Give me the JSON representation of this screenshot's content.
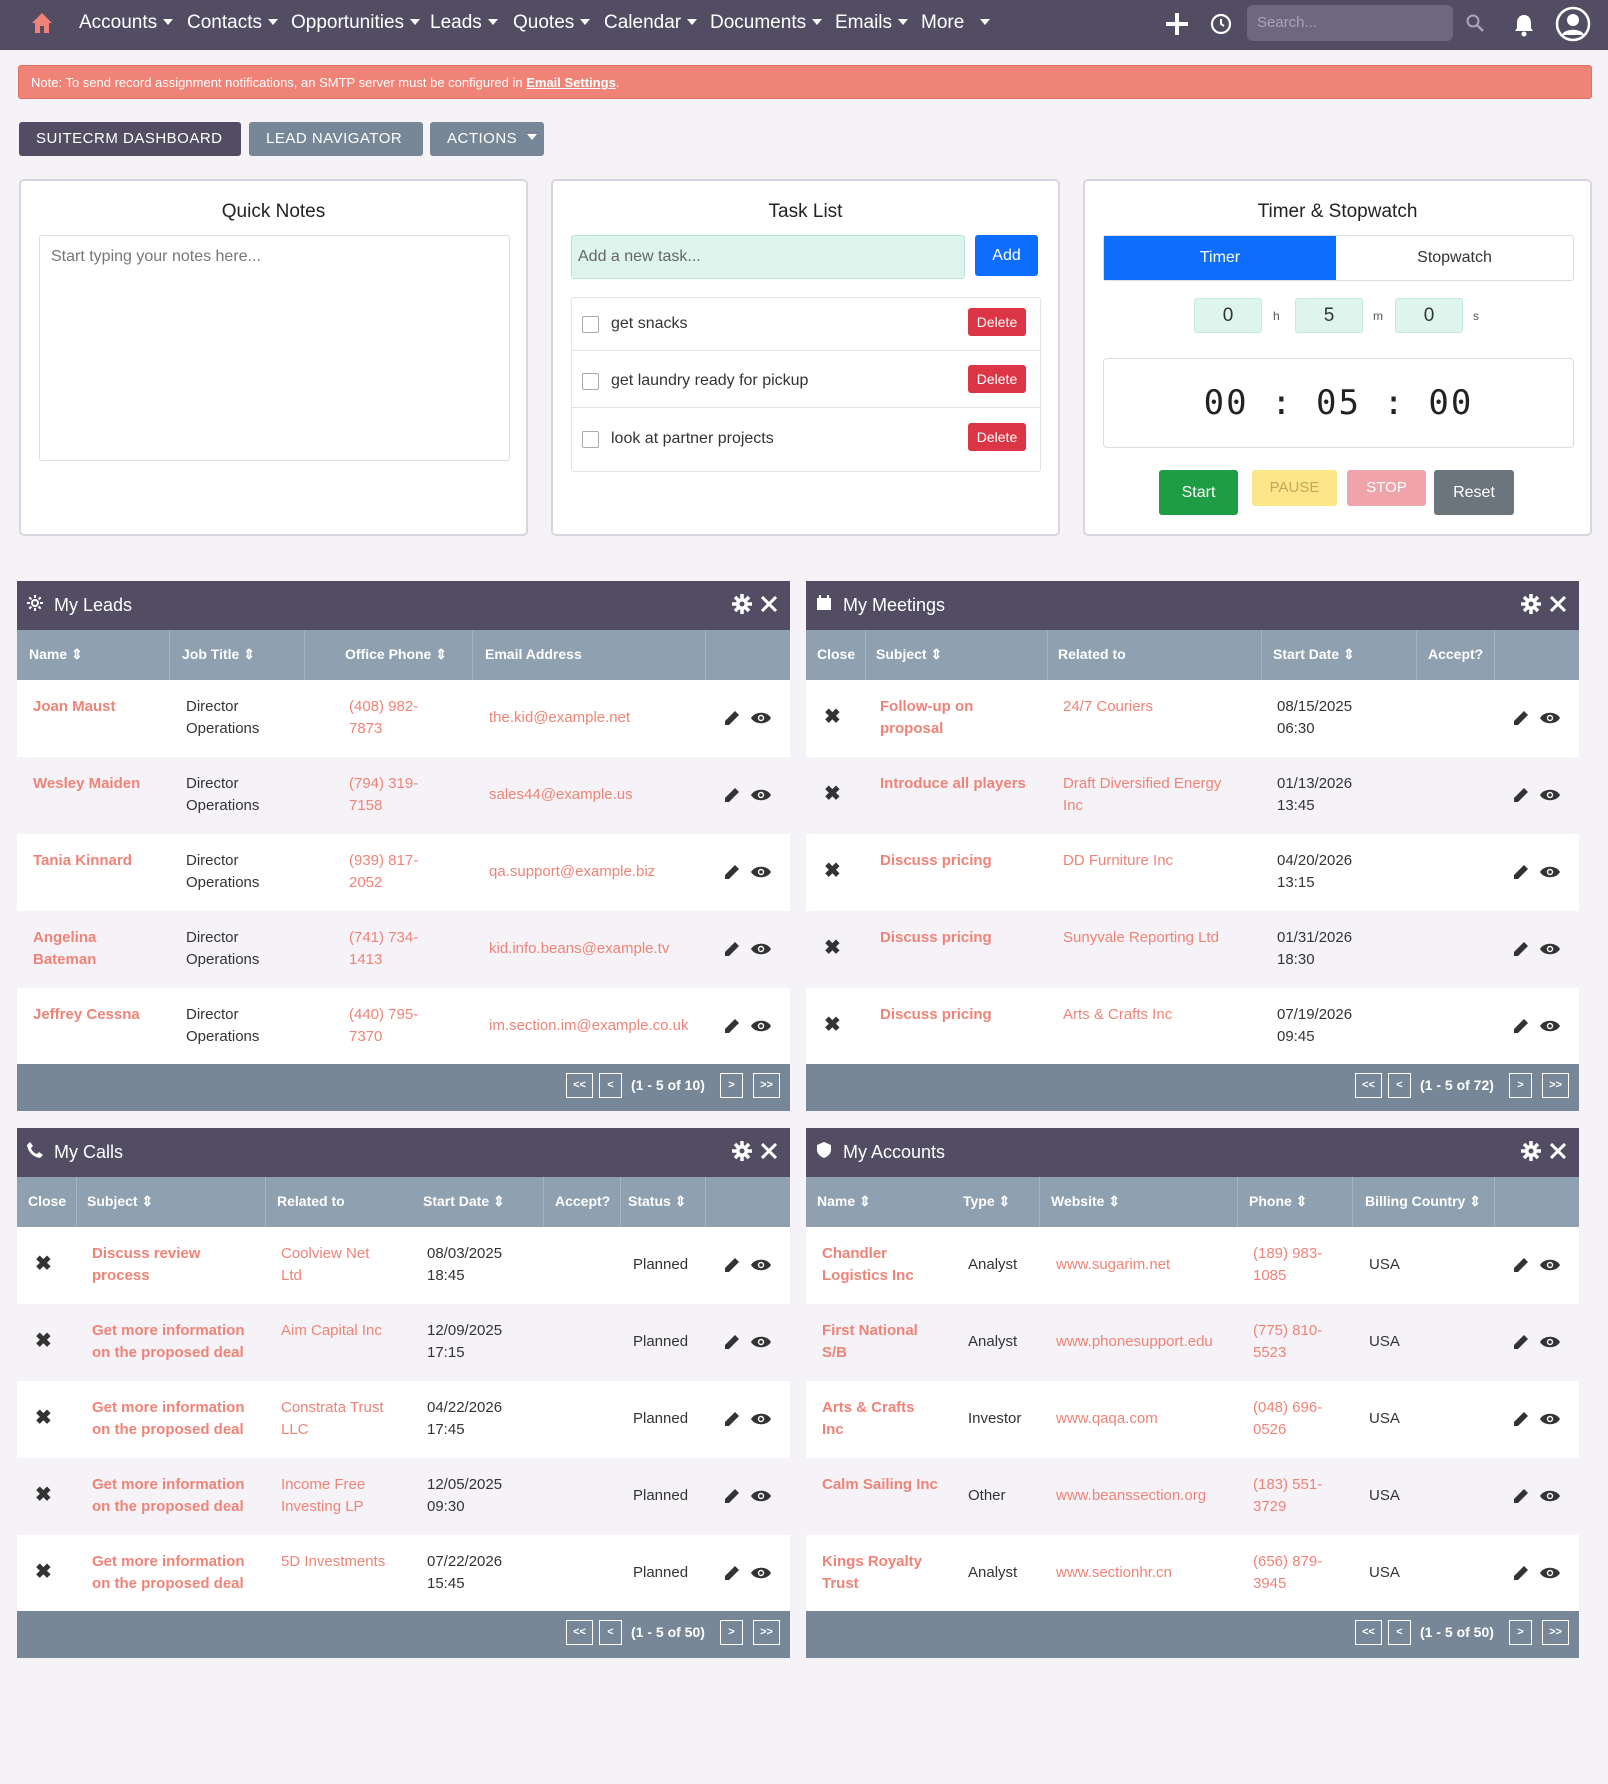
{
  "nav": {
    "items": [
      "Accounts",
      "Contacts",
      "Opportunities",
      "Leads",
      "Quotes",
      "Calendar",
      "Documents",
      "Emails",
      "More"
    ],
    "search_placeholder": "Search..."
  },
  "notice": {
    "text": "Note: To send record assignment notifications, an SMTP server must be configured in ",
    "link": "Email Settings",
    "end": "."
  },
  "tabs": {
    "dashboard": "SUITECRM DASHBOARD",
    "navigator": "LEAD NAVIGATOR",
    "actions": "ACTIONS"
  },
  "quick_notes": {
    "title": "Quick Notes",
    "placeholder": "Start typing your notes here..."
  },
  "task_list": {
    "title": "Task List",
    "placeholder": "Add a new task...",
    "add": "Add",
    "delete": "Delete",
    "tasks": [
      "get snacks",
      "get laundry ready for pickup",
      "look at partner projects"
    ]
  },
  "timer": {
    "title": "Timer & Stopwatch",
    "tab_timer": "Timer",
    "tab_stopwatch": "Stopwatch",
    "h": "0",
    "m": "5",
    "s": "0",
    "h_label": "h",
    "m_label": "m",
    "s_label": "s",
    "display": "00 : 05 : 00",
    "start": "Start",
    "pause": "PAUSE",
    "stop": "STOP",
    "reset": "Reset"
  },
  "leads": {
    "title": "My Leads",
    "cols": [
      "Name",
      "Job Title",
      "Office Phone",
      "Email Address"
    ],
    "rows": [
      {
        "name": [
          "Joan Maust",
          ""
        ],
        "job": [
          "Director",
          "Operations"
        ],
        "phone": [
          "(408) 982-",
          "7873"
        ],
        "email": "the.kid@example.net"
      },
      {
        "name": [
          "Wesley Maiden",
          ""
        ],
        "job": [
          "Director",
          "Operations"
        ],
        "phone": [
          "(794) 319-",
          "7158"
        ],
        "email": "sales44@example.us"
      },
      {
        "name": [
          "Tania Kinnard",
          ""
        ],
        "job": [
          "Director",
          "Operations"
        ],
        "phone": [
          "(939) 817-",
          "2052"
        ],
        "email": "qa.support@example.biz"
      },
      {
        "name": [
          "Angelina",
          "Bateman"
        ],
        "job": [
          "Director",
          "Operations"
        ],
        "phone": [
          "(741) 734-",
          "1413"
        ],
        "email": "kid.info.beans@example.tv"
      },
      {
        "name": [
          "Jeffrey Cessna",
          ""
        ],
        "job": [
          "Director",
          "Operations"
        ],
        "phone": [
          "(440) 795-",
          "7370"
        ],
        "email": "im.section.im@example.co.uk"
      }
    ],
    "pager": "(1 - 5 of 10)"
  },
  "meetings": {
    "title": "My Meetings",
    "cols": [
      "Close",
      "Subject",
      "Related to",
      "Start Date",
      "Accept?"
    ],
    "rows": [
      {
        "subject": [
          "Follow-up on",
          "proposal"
        ],
        "related": [
          "24/7 Couriers",
          ""
        ],
        "date": [
          "08/15/2025",
          "06:30"
        ]
      },
      {
        "subject": [
          "Introduce all players",
          ""
        ],
        "related": [
          "Draft Diversified Energy",
          "Inc"
        ],
        "date": [
          "01/13/2026",
          "13:45"
        ]
      },
      {
        "subject": [
          "Discuss pricing",
          ""
        ],
        "related": [
          "DD Furniture Inc",
          ""
        ],
        "date": [
          "04/20/2026",
          "13:15"
        ]
      },
      {
        "subject": [
          "Discuss pricing",
          ""
        ],
        "related": [
          "Sunyvale Reporting Ltd",
          ""
        ],
        "date": [
          "01/31/2026",
          "18:30"
        ]
      },
      {
        "subject": [
          "Discuss pricing",
          ""
        ],
        "related": [
          "Arts & Crafts Inc",
          ""
        ],
        "date": [
          "07/19/2026",
          "09:45"
        ]
      }
    ],
    "pager": "(1 - 5 of 72)"
  },
  "calls": {
    "title": "My Calls",
    "cols": [
      "Close",
      "Subject",
      "Related to",
      "Start Date",
      "Accept?",
      "Status"
    ],
    "rows": [
      {
        "subject": [
          "Discuss review",
          "process"
        ],
        "related": [
          "Coolview Net",
          "Ltd"
        ],
        "date": [
          "08/03/2025",
          "18:45"
        ],
        "status": "Planned"
      },
      {
        "subject": [
          "Get more information",
          "on the proposed deal"
        ],
        "related": [
          "Aim Capital Inc",
          ""
        ],
        "date": [
          "12/09/2025",
          "17:15"
        ],
        "status": "Planned"
      },
      {
        "subject": [
          "Get more information",
          "on the proposed deal"
        ],
        "related": [
          "Constrata Trust",
          "LLC"
        ],
        "date": [
          "04/22/2026",
          "17:45"
        ],
        "status": "Planned"
      },
      {
        "subject": [
          "Get more information",
          "on the proposed deal"
        ],
        "related": [
          "Income Free",
          "Investing LP"
        ],
        "date": [
          "12/05/2025",
          "09:30"
        ],
        "status": "Planned"
      },
      {
        "subject": [
          "Get more information",
          "on the proposed deal"
        ],
        "related": [
          "5D Investments",
          ""
        ],
        "date": [
          "07/22/2026",
          "15:45"
        ],
        "status": "Planned"
      }
    ],
    "pager": "(1 - 5 of 50)"
  },
  "accounts": {
    "title": "My Accounts",
    "cols": [
      "Name",
      "Type",
      "Website",
      "Phone",
      "Billing Country"
    ],
    "rows": [
      {
        "name": [
          "Chandler",
          "Logistics Inc"
        ],
        "type": "Analyst",
        "web": "www.sugarim.net",
        "phone": [
          "(189) 983-",
          "1085"
        ],
        "country": "USA"
      },
      {
        "name": [
          "First National",
          "S/B"
        ],
        "type": "Analyst",
        "web": "www.phonesupport.edu",
        "phone": [
          "(775) 810-",
          "5523"
        ],
        "country": "USA"
      },
      {
        "name": [
          "Arts & Crafts",
          "Inc"
        ],
        "type": "Investor",
        "web": "www.qaqa.com",
        "phone": [
          "(048) 696-",
          "0526"
        ],
        "country": "USA"
      },
      {
        "name": [
          "Calm Sailing Inc",
          ""
        ],
        "type": "Other",
        "web": "www.beanssection.org",
        "phone": [
          "(183) 551-",
          "3729"
        ],
        "country": "USA"
      },
      {
        "name": [
          "Kings Royalty",
          "Trust"
        ],
        "type": "Analyst",
        "web": "www.sectionhr.cn",
        "phone": [
          "(656) 879-",
          "3945"
        ],
        "country": "USA"
      }
    ],
    "pager": "(1 - 5 of 50)"
  },
  "pager_buttons": {
    "first": "<<",
    "prev": "<",
    "next": ">",
    "last": ">>"
  }
}
